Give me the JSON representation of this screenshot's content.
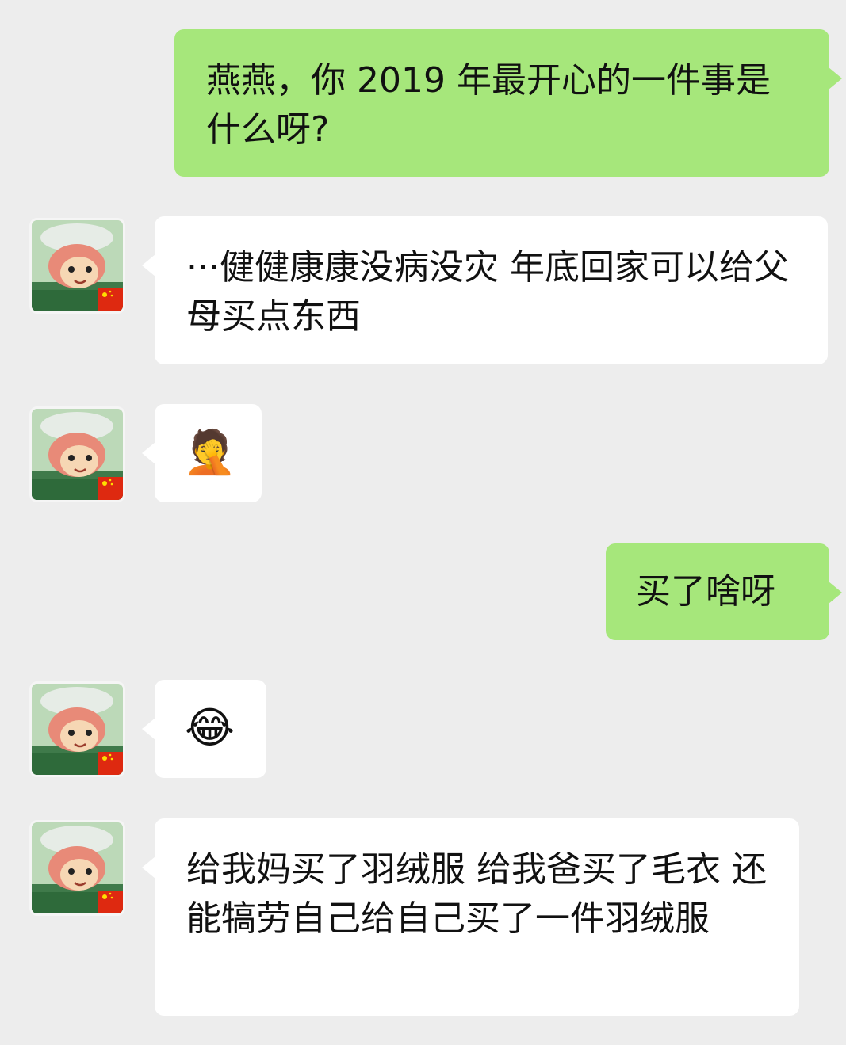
{
  "messages": [
    {
      "side": "right",
      "text": "燕燕，你 2019 年最开心的一件事是什么呀?"
    },
    {
      "side": "left",
      "avatar": "ponyo-avatar",
      "text": "···健健康康没病没灾 年底回家可以给父母买点东西"
    },
    {
      "side": "left",
      "avatar": "ponyo-avatar",
      "emoji": "🤦",
      "emoji_name": "facepalm-laughing-emoji"
    },
    {
      "side": "right",
      "text": "买了啥呀"
    },
    {
      "side": "left",
      "avatar": "ponyo-avatar",
      "emoji": "😂",
      "emoji_name": "tears-of-joy-emoji"
    },
    {
      "side": "left",
      "avatar": "ponyo-avatar",
      "text": "给我妈买了羽绒服 给我爸买了毛衣 还能犒劳自己给自己买了一件羽绒服"
    }
  ],
  "colors": {
    "background": "#ededed",
    "sent_bubble": "#a6e77b",
    "received_bubble": "#ffffff",
    "text": "#111111"
  }
}
